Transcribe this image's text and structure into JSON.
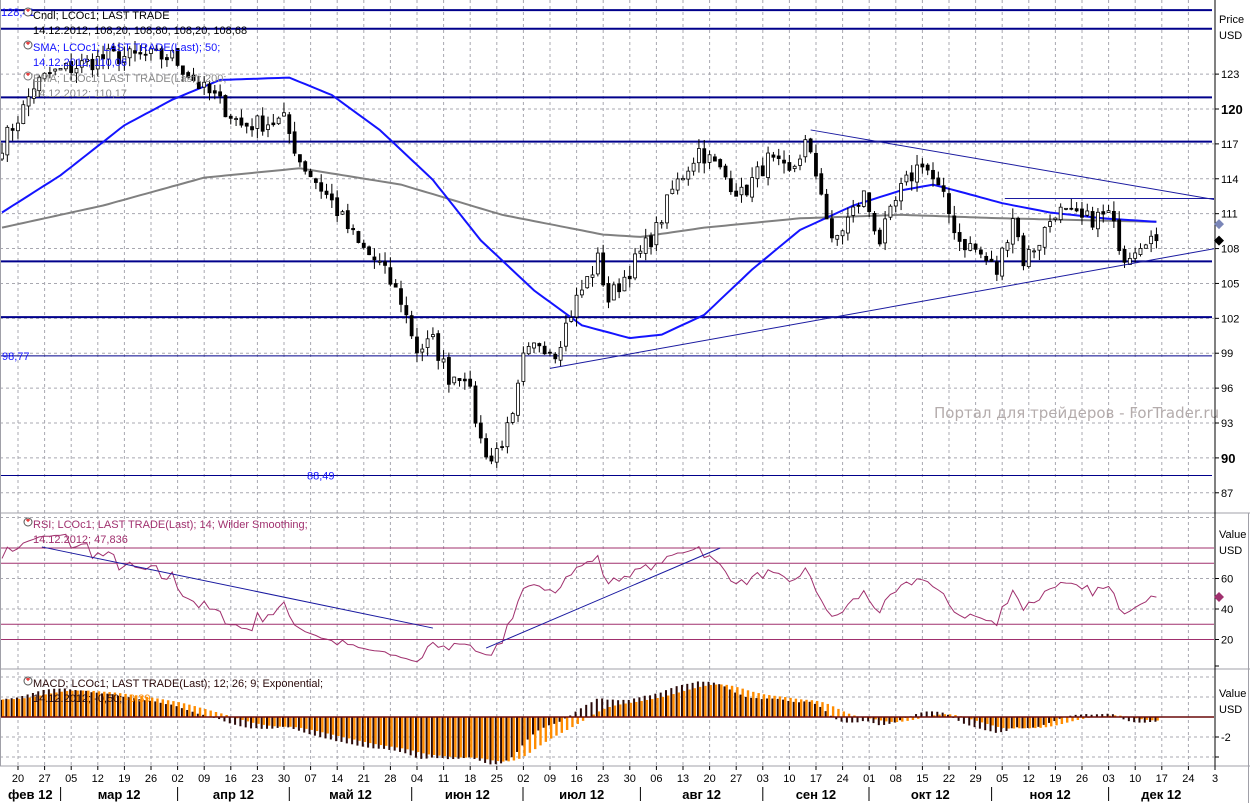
{
  "chart_data": [
    {
      "type": "candlestick",
      "title": "Cndl; LCOc1; LAST TRADE",
      "last_values": "14.12.2012; 108,20; 108,80; 108,20; 108,68",
      "axis_title": "Price",
      "axis_unit": "USD",
      "yticks": [
        87,
        90,
        93,
        96,
        99,
        102,
        105,
        108,
        111,
        114,
        117,
        120,
        123
      ],
      "bold_ticks": [
        90,
        120
      ],
      "ylim": [
        85.5,
        129
      ],
      "close_path_anchors": [
        [
          0,
          117
        ],
        [
          4,
          120
        ],
        [
          6,
          122
        ],
        [
          9,
          123
        ],
        [
          20,
          124.5
        ],
        [
          32,
          124.5
        ],
        [
          38,
          121.6
        ],
        [
          40,
          121
        ],
        [
          45,
          118.6
        ],
        [
          53,
          119
        ],
        [
          56,
          115.6
        ],
        [
          62,
          112
        ],
        [
          67,
          108.3
        ],
        [
          71,
          106.6
        ],
        [
          75,
          103.6
        ],
        [
          78,
          99.3
        ],
        [
          81,
          100
        ],
        [
          84,
          97
        ],
        [
          87,
          97.3
        ],
        [
          90,
          91.5
        ],
        [
          92,
          89.8
        ],
        [
          96,
          93.2
        ],
        [
          98,
          98.4
        ],
        [
          101,
          100
        ],
        [
          104,
          99.2
        ],
        [
          108,
          103.6
        ],
        [
          112,
          107
        ],
        [
          114,
          103.6
        ],
        [
          118,
          106.2
        ],
        [
          123,
          109.6
        ],
        [
          126,
          113
        ],
        [
          131,
          116.5
        ],
        [
          134,
          115.2
        ],
        [
          139,
          112.6
        ],
        [
          144,
          115.6
        ],
        [
          148,
          114.3
        ],
        [
          151,
          117
        ],
        [
          154,
          113.1
        ],
        [
          156,
          108.3
        ],
        [
          159,
          110.5
        ],
        [
          162,
          112.6
        ],
        [
          165,
          108.7
        ],
        [
          169,
          113
        ],
        [
          173,
          115.6
        ],
        [
          177,
          112.2
        ],
        [
          180,
          108.7
        ],
        [
          183,
          107.9
        ],
        [
          187,
          106
        ],
        [
          190,
          110.9
        ],
        [
          192,
          107
        ],
        [
          195,
          108.7
        ],
        [
          198,
          111.3
        ],
        [
          203,
          110.4
        ],
        [
          208,
          110.9
        ],
        [
          211,
          107.4
        ],
        [
          215,
          109.1
        ],
        [
          217,
          108.68
        ]
      ],
      "sma": {
        "label": "SMA; LCOc1; LAST TRADE(Last);  50;",
        "value": "14.12.2012; 110,06",
        "color": "#1414ff",
        "points": [
          [
            0,
            111.1
          ],
          [
            11,
            114.3
          ],
          [
            23,
            118.6
          ],
          [
            32,
            120.8
          ],
          [
            41,
            122.5
          ],
          [
            54,
            122.7
          ],
          [
            62,
            121.2
          ],
          [
            71,
            118.2
          ],
          [
            81,
            113.9
          ],
          [
            90,
            108.7
          ],
          [
            100,
            104.4
          ],
          [
            109,
            101.4
          ],
          [
            118,
            100.3
          ],
          [
            124,
            100.6
          ],
          [
            132,
            102.3
          ],
          [
            141,
            106.2
          ],
          [
            150,
            109.6
          ],
          [
            160,
            111.7
          ],
          [
            169,
            113.0
          ],
          [
            175,
            113.5
          ],
          [
            180,
            112.9
          ],
          [
            188,
            111.9
          ],
          [
            197,
            111.1
          ],
          [
            207,
            110.6
          ],
          [
            217,
            110.3
          ]
        ]
      },
      "ema": {
        "label": "EMA; LCOc1; LAST TRADE(Last);  200;",
        "value": "14.12.2012; 110,17",
        "color": "#808080",
        "points": [
          [
            0,
            109.8
          ],
          [
            19,
            111.7
          ],
          [
            38,
            114.1
          ],
          [
            56,
            114.9
          ],
          [
            75,
            113.5
          ],
          [
            94,
            110.9
          ],
          [
            113,
            109.2
          ],
          [
            120,
            109.0
          ],
          [
            132,
            109.8
          ],
          [
            150,
            110.6
          ],
          [
            169,
            110.9
          ],
          [
            188,
            110.6
          ],
          [
            217,
            110.3
          ]
        ]
      },
      "levels": [
        128.5,
        126.9,
        121.0,
        117.2,
        106.9,
        102.1
      ],
      "labeled_levels": [
        {
          "value": 98.77,
          "label": "98,77"
        },
        {
          "value": 88.49,
          "label": "88,49"
        }
      ],
      "top_label": "128,41",
      "trendlines": [
        [
          [
            152,
            118.2
          ],
          [
            228,
            112.2
          ]
        ],
        [
          [
            103,
            97.7
          ],
          [
            228,
            108.0
          ]
        ],
        [
          [
            188.5,
            112.3
          ],
          [
            228,
            112.3
          ]
        ]
      ],
      "markers": [
        {
          "value": 110.1,
          "color": "#7a86b8"
        },
        {
          "value": 108.68,
          "color": "#000000"
        }
      ],
      "watermark": "Портал для трейдеров - ForTrader.ru"
    },
    {
      "type": "line",
      "title": "RSI; LCOc1; LAST TRADE(Last);  14; Wilder Smoothing;",
      "last_values": "14.12.2012; 47,836",
      "axis_title": "Value",
      "axis_unit": "USD",
      "yticks": [
        20,
        40,
        60
      ],
      "levels": [
        80,
        70,
        30,
        20
      ],
      "color": "#a0306e",
      "trendlines": [
        [
          [
            7.5,
            80.7
          ],
          [
            81,
            27.5
          ]
        ],
        [
          [
            91,
            14.4
          ],
          [
            135,
            80
          ]
        ]
      ],
      "last": 47.836
    },
    {
      "type": "bar",
      "title": "MACD; LCOc1; LAST TRADE(Last);  12; 26; 9; Exponential;",
      "last_values_prefix": "14.12.2012; -0,50; ",
      "last_signal": "-0,39",
      "axis_title": "Value",
      "axis_unit": "USD",
      "yticks": [
        -2
      ],
      "series": [
        {
          "name": "MACD",
          "color": "#2a0a0a"
        },
        {
          "name": "Signal",
          "color": "#ff8c00"
        }
      ]
    }
  ],
  "x_axis": {
    "week_labels": [
      "20",
      "27",
      "05",
      "12",
      "19",
      "26",
      "02",
      "09",
      "16",
      "23",
      "30",
      "07",
      "14",
      "21",
      "28",
      "04",
      "11",
      "18",
      "25",
      "02",
      "09",
      "16",
      "23",
      "30",
      "06",
      "13",
      "20",
      "27",
      "03",
      "10",
      "17",
      "24",
      "01",
      "08",
      "15",
      "22",
      "29",
      "05",
      "12",
      "19",
      "26",
      "03",
      "10",
      "17",
      "24",
      "3"
    ],
    "month_labels": [
      "фев 12",
      "мар 12",
      "апр 12",
      "май 12",
      "июн 12",
      "июл 12",
      "авг 12",
      "сен 12",
      "окт 12",
      "ноя 12",
      "дек 12"
    ]
  }
}
